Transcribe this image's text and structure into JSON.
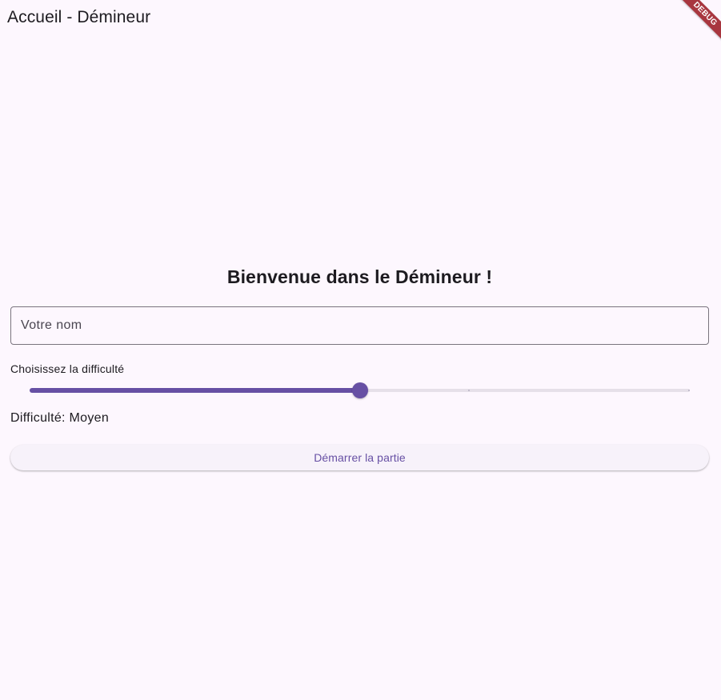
{
  "app_bar": {
    "title": "Accueil - Démineur"
  },
  "debug_banner": {
    "label": "DEBUG",
    "color": "#a8363f"
  },
  "main": {
    "welcome": "Bienvenue dans le Démineur !",
    "name_field": {
      "placeholder": "Votre nom",
      "value": ""
    },
    "difficulty_label": "Choisissez la difficulté",
    "slider": {
      "min": 0,
      "max": 2,
      "value": 1,
      "divisions": 2
    },
    "difficulty_value": "Difficulté: Moyen",
    "start_button": "Démarrer la partie"
  },
  "colors": {
    "background": "#fdf7fe",
    "accent": "#6750a4",
    "track_inactive": "#e6e0e9",
    "text": "#1d1b20",
    "outline": "#79747e"
  }
}
